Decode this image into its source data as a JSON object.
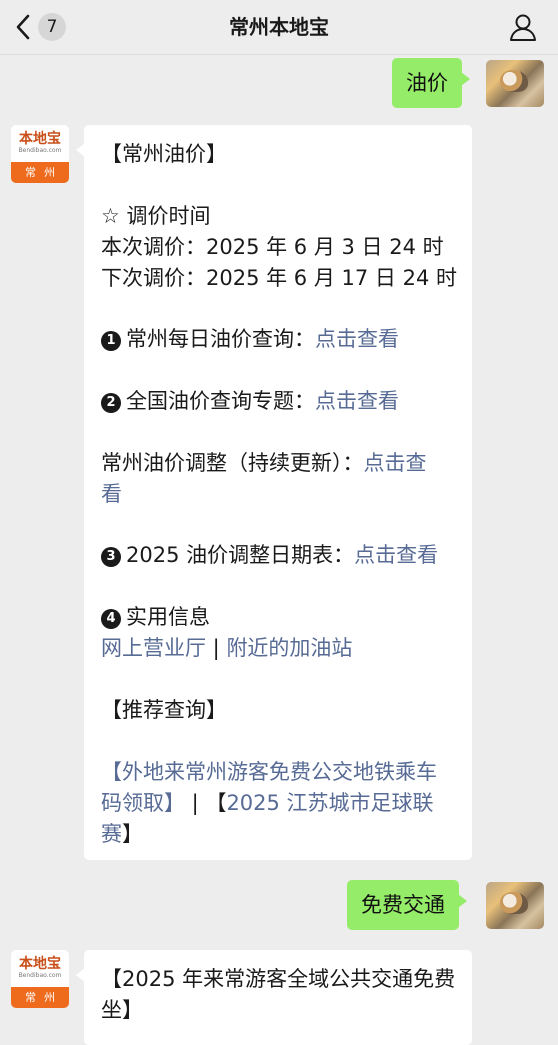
{
  "header": {
    "title": "常州本地宝",
    "unread_count": "7"
  },
  "messages": {
    "msg1": {
      "text": "油价"
    },
    "card1": {
      "title": "【常州油价】",
      "section_price_time": "☆ 调价时间",
      "this_adjust": "本次调价：2025 年 6 月 3 日 24 时",
      "next_adjust": "下次调价：2025 年 6 月 17 日 24 时",
      "item1_num": "1",
      "item1_text": "常州每日油价查询：",
      "item1_link": "点击查看",
      "item2_num": "2",
      "item2_text": "全国油价查询专题：",
      "item2_link": "点击查看",
      "adjust_text": "常州油价调整（持续更新）：",
      "adjust_link_part1": "点击查",
      "adjust_link_part2": "看",
      "item3_num": "3",
      "item3_text": "2025 油价调整日期表：",
      "item3_link": "点击查看",
      "item4_num": "4",
      "item4_text": "实用信息",
      "online_hall_link": "网上营业厅",
      "separator": " | ",
      "gas_station_link": "附近的加油站",
      "recommend_title": "【推荐查询】",
      "rec1_line1": "【外地来常州游客免费公交地铁乘车",
      "rec1_line2_link": "码领取】",
      "rec_sep": "  |  ",
      "rec2_open": "【",
      "rec2_line2_link": "2025 江苏城市足球联",
      "rec2_line3_link": "赛",
      "rec2_close": "】"
    },
    "msg2": {
      "text": "免费交通"
    },
    "card2": {
      "line1": "【2025 年来常游客全域公共交通免费",
      "line2": "坐】"
    }
  },
  "avatars": {
    "bot_logo_text": "本地宝",
    "bot_logo_domain": "Bendibao.com",
    "bot_city": "常州"
  },
  "colors": {
    "page_bg": "#ededed",
    "bubble_self": "#95ec69",
    "bubble_other": "#ffffff",
    "link": "#576b95",
    "logo_orange": "#ee6a1d"
  }
}
